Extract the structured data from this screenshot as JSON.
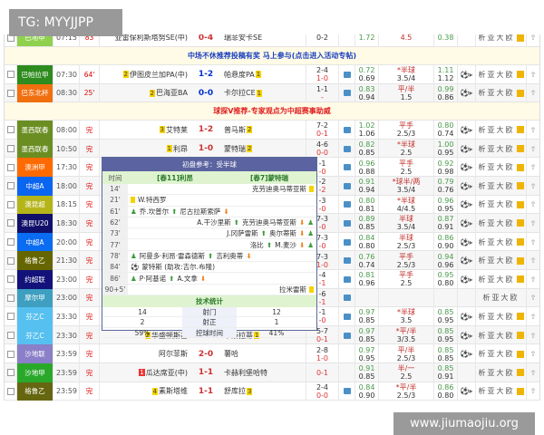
{
  "watermarks": {
    "top": "TG: MYYJJPP",
    "bottom": "www.jiumaojiu.org"
  },
  "analysis_label": "析亚大欧",
  "partial_row": {
    "league": "巴地甲",
    "color": "#8fd14f",
    "time": "07:15",
    "status": "83",
    "home": "亚雷保利斯塔努SE(中)",
    "score": "0-4",
    "away": "瑞菲安卡SE",
    "half": [
      "0-2",
      ""
    ],
    "o1": [
      "1.72",
      ""
    ],
    "o2": [
      "4.5",
      ""
    ],
    "o3": [
      "0.38",
      ""
    ]
  },
  "banners": [
    {
      "text": "中场不休推荐投稿有奖 马上参与(点击进入活动专帖)",
      "color": "#1a3fbf"
    },
    {
      "text": "球探V推荐-专家观点为中超赛事助威",
      "color": "#e02020"
    }
  ],
  "rows_a": [
    {
      "league": "巴帕拉甲",
      "color": "#2e8b1e",
      "time": "07:30",
      "status": "64'",
      "hrank": "2",
      "home": "伊图皮兰加PA(中)",
      "score": "1-2",
      "away": "帕悬度PA",
      "arank": "1",
      "half": [
        "2-4",
        "1-0"
      ],
      "icon": true,
      "o1": [
        "0.72",
        "0.69"
      ],
      "o2": [
        "*半球",
        "3.5/4"
      ],
      "o3": [
        "1.11",
        "1.12"
      ],
      "ball": true,
      "live": true
    },
    {
      "league": "巴东北杯",
      "color": "#f07010",
      "time": "08:30",
      "status": "25'",
      "hrank": "2",
      "home": "巴海亚BA",
      "score": "0-0",
      "away": "卡尔拉CE",
      "arank": "1",
      "half": [
        "1-1",
        "-"
      ],
      "icon": true,
      "o1": [
        "0.83",
        "0.94"
      ],
      "o2": [
        "平/半",
        "1.5"
      ],
      "o3": [
        "0.99",
        "0.86"
      ],
      "ball": true,
      "live": true
    }
  ],
  "rows_b": [
    {
      "league": "墨西联春",
      "color": "#6b8e23",
      "time": "08:00",
      "status": "完",
      "hrank": "3",
      "home": "艾特莱",
      "score": "1-2",
      "away": "普马斯",
      "arank": "2",
      "half": [
        "7-2",
        "0-1"
      ],
      "icon": true,
      "o1": [
        "1.02",
        "1.06"
      ],
      "o2": [
        "平手",
        "2.5/3"
      ],
      "o3": [
        "0.80",
        "0.74"
      ],
      "ball": true
    },
    {
      "league": "墨西联春",
      "color": "#6b8e23",
      "time": "10:50",
      "status": "完",
      "hrank": "1",
      "home": "利昂",
      "score": "1-0",
      "away": "蒙特瑞",
      "arank": "2",
      "half": [
        "4-6",
        "0-0"
      ],
      "icon": true,
      "o1": [
        "0.82",
        "0.85"
      ],
      "o2": [
        "*半球",
        "2.5"
      ],
      "o3": [
        "1.00",
        "0.95"
      ],
      "ball": true
    },
    {
      "league": "澳洲甲",
      "color": "#ff6a00",
      "time": "17:30",
      "status": "完",
      "half": [
        "-1",
        "-0"
      ],
      "icon": true,
      "o1": [
        "0.96",
        "0.88"
      ],
      "o2": [
        "平手",
        "2.5"
      ],
      "o3": [
        "0.92",
        "0.98"
      ],
      "ball": true
    },
    {
      "league": "中超A",
      "color": "#0a66f0",
      "time": "18:00",
      "status": "完",
      "half": [
        "-2",
        "-2"
      ],
      "icon": true,
      "o1": [
        "0.91",
        "0.94"
      ],
      "o2": [
        "*球半/两",
        "3.5/4"
      ],
      "o3": [
        "0.79",
        "0.76"
      ],
      "ball": true
    },
    {
      "league": "澳昆超",
      "color": "#b5b51a",
      "time": "18:15",
      "status": "完",
      "half": [
        "-3",
        "-0"
      ],
      "icon": true,
      "o1": [
        "0.80",
        "0.81"
      ],
      "o2": [
        "*半球",
        "4/4.5"
      ],
      "o3": [
        "0.96",
        "0.95"
      ],
      "ball": true
    },
    {
      "league": "澳昆U20",
      "color": "#10106b",
      "time": "18:30",
      "status": "完",
      "half": [
        "7-3",
        "-0"
      ],
      "icon": true,
      "o1": [
        "0.89",
        "0.85"
      ],
      "o2": [
        "半球",
        "3.5/4"
      ],
      "o3": [
        "0.87",
        "0.91"
      ],
      "ball": true
    },
    {
      "league": "中超A",
      "color": "#0a6cf0",
      "time": "20:00",
      "status": "完",
      "half": [
        "7-3",
        "-0"
      ],
      "icon": true,
      "o1": [
        "0.84",
        "0.80"
      ],
      "o2": [
        "半球",
        "2.5/3"
      ],
      "o3": [
        "0.86",
        "0.90"
      ],
      "ball": true
    },
    {
      "league": "格鲁乙",
      "color": "#666600",
      "time": "21:30",
      "status": "完",
      "half": [
        "7-3",
        "1-0"
      ],
      "icon": true,
      "o1": [
        "0.76",
        "0.74"
      ],
      "o2": [
        "平手",
        "2.5/3"
      ],
      "o3": [
        "0.94",
        "0.96"
      ],
      "ball": true
    },
    {
      "league": "约超联",
      "color": "#12127a",
      "time": "23:00",
      "status": "完",
      "half": [
        "-4",
        "-1"
      ],
      "icon": true,
      "o1": [
        "0.81",
        "0.96"
      ],
      "o2": [
        "平手",
        "2.5"
      ],
      "o3": [
        "0.95",
        "0.80"
      ],
      "ball": true
    },
    {
      "league": "摩尔甲",
      "color": "#3e9fc0",
      "time": "23:00",
      "status": "完",
      "half": [
        "-6",
        "-1"
      ],
      "icon": true,
      "o1": [
        "",
        ""
      ],
      "o2": [
        "",
        ""
      ],
      "o3": [
        "",
        ""
      ],
      "ball": false
    },
    {
      "league": "芬乙C",
      "color": "#56c0f0",
      "time": "23:30",
      "status": "完",
      "half": [
        "-1",
        "-0"
      ],
      "icon": true,
      "o1": [
        "0.97",
        "0.85"
      ],
      "o2": [
        "*半球",
        "3.5"
      ],
      "o3": [
        "0.85",
        "0.95"
      ],
      "ball": true
    },
    {
      "league": "芬乙C",
      "color": "#56c0f0",
      "time": "23:30",
      "status": "完",
      "hrank": "2",
      "home": "华盛顿斯基",
      "score": "3-2",
      "away": "韦斯拉蒂",
      "arank": "1",
      "half": [
        "5-7",
        "0-1"
      ],
      "icon": true,
      "o1": [
        "0.97",
        "0.85"
      ],
      "o2": [
        "*平/半",
        "3/3.5"
      ],
      "o3": [
        "0.85",
        "0.95"
      ],
      "ball": true
    },
    {
      "league": "沙地联",
      "color": "#8a7fc8",
      "time": "23:59",
      "status": "完",
      "home": "阿尔菲斯",
      "score": "2-0",
      "away": "薯哈",
      "half": [
        "2-8",
        "1-0"
      ],
      "icon": false,
      "o1": [
        "0.97",
        "0.95"
      ],
      "o2": [
        "平/半",
        "2.5/3"
      ],
      "o3": [
        "0.85",
        "0.85"
      ],
      "ball": true
    },
    {
      "league": "沙地甲",
      "color": "#2aa82a",
      "time": "23:59",
      "status": "完",
      "hrank": "1",
      "hred": true,
      "home": "瓜达席亚(中)",
      "score": "1-1",
      "away": "卡赫利堡哈特",
      "half": [
        "",
        "0-1"
      ],
      "icon": false,
      "o1": [
        "0.91",
        "0.85"
      ],
      "o2": [
        "半/一",
        "2.5"
      ],
      "o3": [
        "0.85",
        "0.91"
      ],
      "ball": false
    },
    {
      "league": "格鲁乙",
      "color": "#666611",
      "time": "23:59",
      "status": "完",
      "hrank": "4",
      "home": "素斯塔维",
      "score": "1-1",
      "away": "舒库拉",
      "arank": "3",
      "half": [
        "2-4",
        "0-0"
      ],
      "icon": true,
      "o1": [
        "0.84",
        "0.90"
      ],
      "o2": [
        "*平/半",
        "2.5/3"
      ],
      "o3": [
        "0.86",
        "0.80"
      ],
      "ball": true
    }
  ],
  "popup": {
    "title": "初盘参考：受半球",
    "col_time": "时间",
    "home": "[春11]利昂",
    "away": "[春7]蒙特瑞",
    "events": [
      {
        "time": "14'",
        "side": "away",
        "type": "yellow",
        "text": "克劳迪奥马蒂亚斯"
      },
      {
        "time": "21'",
        "side": "home",
        "type": "yellow",
        "text": "W.特西罗"
      },
      {
        "time": "61'",
        "side": "home",
        "type": "sub",
        "in": "乔.坎普尔",
        "out": "尼古拉斯索萨"
      },
      {
        "time": "62'",
        "side": "away",
        "type": "sub",
        "in": "A.干沙里斯",
        "out": "克劳迪奥马蒂亚斯"
      },
      {
        "time": "73'",
        "side": "away",
        "type": "sub",
        "in": "J.冈萨雷斯",
        "out": "奥尔蒂斯"
      },
      {
        "time": "77'",
        "side": "away",
        "type": "sub",
        "in": "洛比",
        "out": "M.麦沙"
      },
      {
        "time": "78'",
        "side": "home",
        "type": "sub",
        "in": "阿曼多·利昂·雷森德斯",
        "out": "吉利奥蒂"
      },
      {
        "time": "84'",
        "side": "home",
        "type": "goal",
        "text": "蒙特斯 (助攻:吉尔.布隆)"
      },
      {
        "time": "86'",
        "side": "home",
        "type": "sub",
        "in": "P·阿基诺",
        "out": "A.文拿"
      },
      {
        "time": "90+5'",
        "side": "away",
        "type": "yellow",
        "text": "拉米雷斯"
      }
    ],
    "stats_title": "技术统计",
    "stats": [
      {
        "home": "14",
        "label": "射门",
        "away": "12"
      },
      {
        "home": "2",
        "label": "射正",
        "away": "1"
      },
      {
        "home": "59%",
        "label": "控球时间",
        "away": "41%"
      }
    ]
  }
}
